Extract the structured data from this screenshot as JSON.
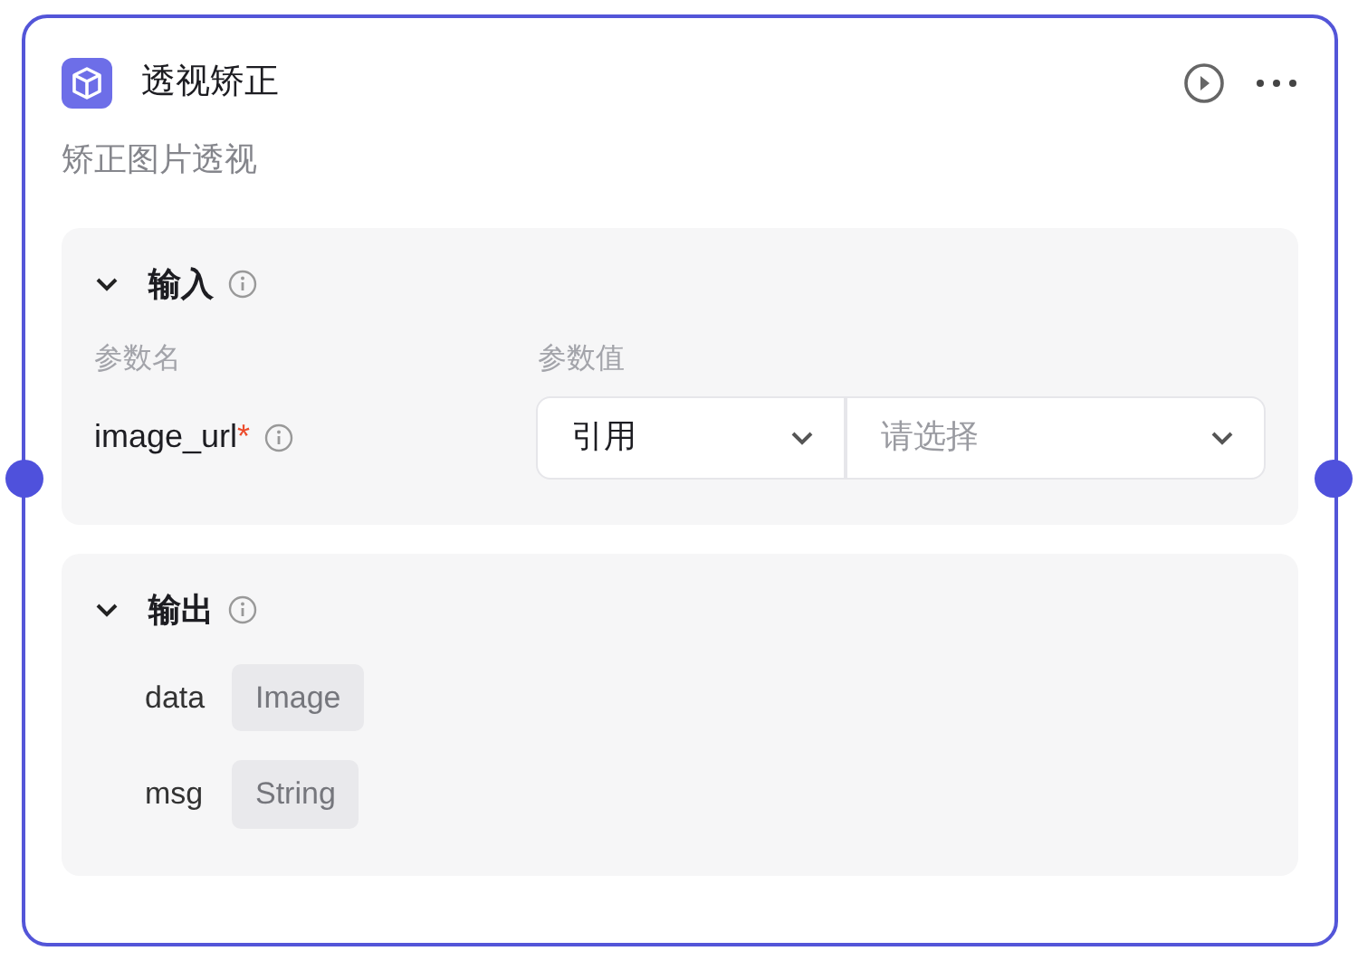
{
  "node": {
    "title": "透视矫正",
    "description": "矫正图片透视"
  },
  "input": {
    "title": "输入",
    "expanded": true,
    "columns": [
      "参数名",
      "参数值"
    ],
    "params": [
      {
        "name": "image_url",
        "required": true,
        "required_mark": "*",
        "source": "引用",
        "placeholder": "请选择"
      }
    ]
  },
  "output": {
    "title": "输出",
    "expanded": true,
    "fields": [
      {
        "name": "data",
        "type": "Image"
      },
      {
        "name": "msg",
        "type": "String"
      }
    ]
  }
}
